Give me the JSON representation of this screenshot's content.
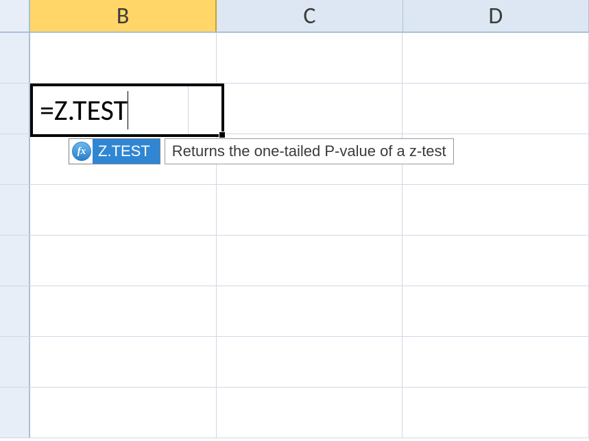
{
  "columns": {
    "selected": "B",
    "others": [
      "C",
      "D"
    ]
  },
  "cell": {
    "formula": "=Z.TEST"
  },
  "autocomplete": {
    "fx_glyph": "fx",
    "function_name": "Z.TEST",
    "description": "Returns the one-tailed P-value of a z-test"
  }
}
